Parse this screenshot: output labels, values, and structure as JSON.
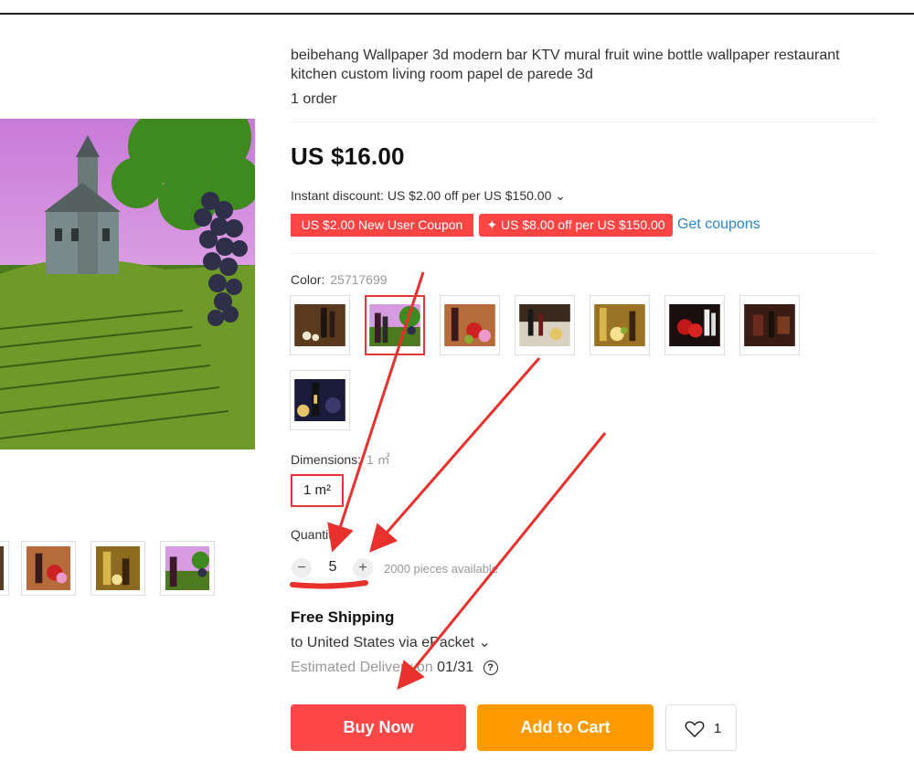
{
  "product": {
    "title": "beibehang Wallpaper 3d modern bar KTV mural fruit wine bottle wallpaper restaurant kitchen custom living room papel de parede 3d",
    "orders": "1 order",
    "price": "US $16.00",
    "instant_discount": "Instant discount: US $2.00 off per US $150.00 ⌄"
  },
  "coupons": {
    "new_user": "US $2.00 New User Coupon",
    "store": "✦ US $8.00 off per US $150.00",
    "get_coupons": "Get coupons"
  },
  "color": {
    "label": "Color:",
    "value": "25717699",
    "options": [
      "wine-bottles-candles",
      "castle-vineyard-grapes",
      "wine-fruit-bowl",
      "wine-glass-cheese",
      "wine-fruit-gold",
      "roses-wine-glasses",
      "dark-wine-bar",
      "wine-bottle-grapes-blue"
    ],
    "selected_index": 1
  },
  "dimensions": {
    "label": "Dimensions:",
    "value": "1 ㎡",
    "option": "1 m²"
  },
  "quantity": {
    "label": "Quantity:",
    "value": "5",
    "minus": "−",
    "plus": "+",
    "available": "2000 pieces available"
  },
  "shipping": {
    "title": "Free Shipping",
    "to": "to United States via ePacket ⌄",
    "estimated_label": "Estimated Delivery on",
    "estimated_date": "01/31",
    "help": "?"
  },
  "actions": {
    "buy_now": "Buy Now",
    "add_to_cart": "Add to Cart",
    "wishlist_count": "1"
  },
  "colors": {
    "accent_red": "#ff4747",
    "cart_orange": "#ff9a00",
    "link_blue": "#2a86c8",
    "annotation_red": "#e8302c"
  }
}
